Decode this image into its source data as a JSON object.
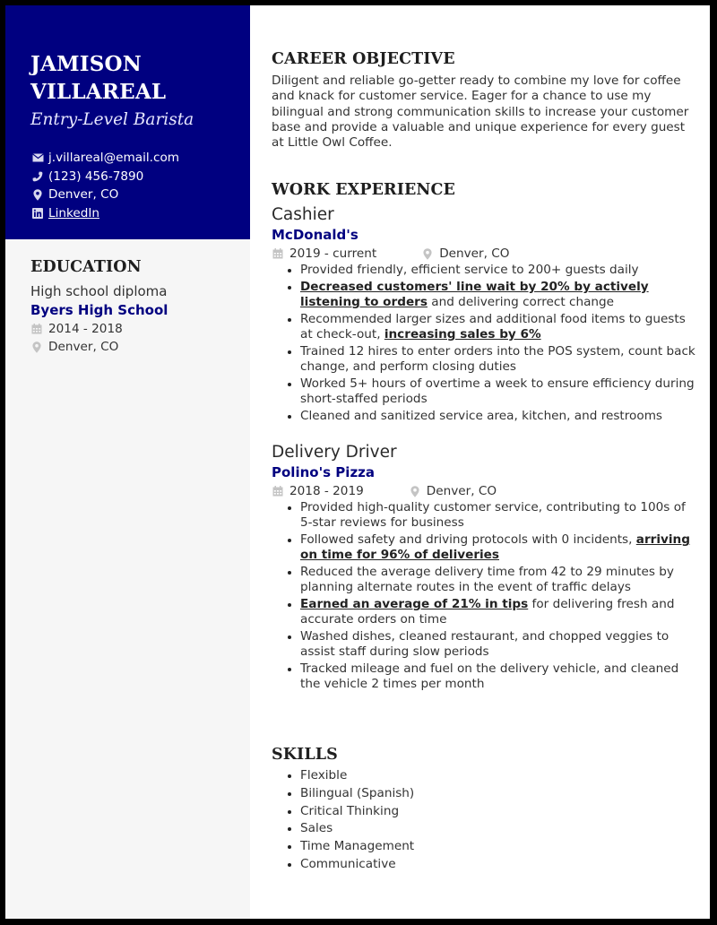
{
  "header": {
    "name_line1": "JAMISON",
    "name_line2": "VILLAREAL",
    "title": "Entry-Level Barista",
    "contacts": [
      {
        "icon": "envelope-icon",
        "text": "j.villareal@email.com",
        "link": false
      },
      {
        "icon": "phone-icon",
        "text": "(123) 456-7890",
        "link": false
      },
      {
        "icon": "location-pin-icon",
        "text": "Denver, CO",
        "link": false
      },
      {
        "icon": "linkedin-icon",
        "text": "LinkedIn",
        "link": true
      }
    ]
  },
  "colors": {
    "accent": "#000080",
    "sidebar_bg": "#f6f6f6",
    "frame": "#000000"
  },
  "education": {
    "heading": "EDUCATION",
    "degree": "High school diploma",
    "school": "Byers High School",
    "dates": "2014 - 2018",
    "location": "Denver, CO"
  },
  "objective": {
    "heading": "CAREER OBJECTIVE",
    "text": "Diligent and reliable go-getter ready to combine my love for coffee and knack for customer service. Eager for a chance to use my bilingual and strong communication skills to increase your customer base and provide a valuable and unique experience for every guest at Little Owl Coffee."
  },
  "work": {
    "heading": "WORK EXPERIENCE",
    "jobs": [
      {
        "title": "Cashier",
        "company": "McDonald's",
        "dates": "2019 - current",
        "location": "Denver, CO",
        "bullets": [
          {
            "bold": "",
            "text": "Provided friendly, efficient service to 200+ guests daily",
            "bold_after": ""
          },
          {
            "bold": "Decreased customers' line wait by 20% by actively listening to orders",
            "text": " and delivering correct change",
            "bold_after": ""
          },
          {
            "bold": "",
            "text": "Recommended larger sizes and additional food items to guests at check-out, ",
            "bold_after": "increasing sales by 6%"
          },
          {
            "bold": "",
            "text": "Trained 12 hires to enter orders into the POS system, count back change, and perform closing duties",
            "bold_after": ""
          },
          {
            "bold": "",
            "text": "Worked 5+ hours of overtime a week to ensure efficiency during short-staffed periods",
            "bold_after": ""
          },
          {
            "bold": "",
            "text": "Cleaned and sanitized service area, kitchen, and restrooms",
            "bold_after": ""
          }
        ]
      },
      {
        "title": "Delivery Driver",
        "company": "Polino's Pizza",
        "dates": "2018 - 2019",
        "location": "Denver, CO",
        "bullets": [
          {
            "bold": "",
            "text": "Provided high-quality customer service, contributing to 100s of 5-star reviews for business",
            "bold_after": ""
          },
          {
            "bold": "",
            "text": "Followed safety and driving protocols with 0 incidents, ",
            "bold_after": "arriving on time for 96% of deliveries"
          },
          {
            "bold": "",
            "text": "Reduced the average delivery time from 42 to 29 minutes by planning alternate routes in the event of traffic delays",
            "bold_after": ""
          },
          {
            "bold": "Earned an average of 21% in tips",
            "text": " for delivering fresh and accurate orders on time",
            "bold_after": ""
          },
          {
            "bold": "",
            "text": "Washed dishes, cleaned restaurant, and chopped veggies to assist staff during slow periods",
            "bold_after": ""
          },
          {
            "bold": "",
            "text": "Tracked mileage and fuel on the delivery vehicle, and cleaned the vehicle 2 times per month",
            "bold_after": ""
          }
        ]
      }
    ]
  },
  "skills": {
    "heading": "SKILLS",
    "items": [
      "Flexible",
      "Bilingual (Spanish)",
      "Critical Thinking",
      "Sales",
      "Time Management",
      "Communicative"
    ]
  }
}
